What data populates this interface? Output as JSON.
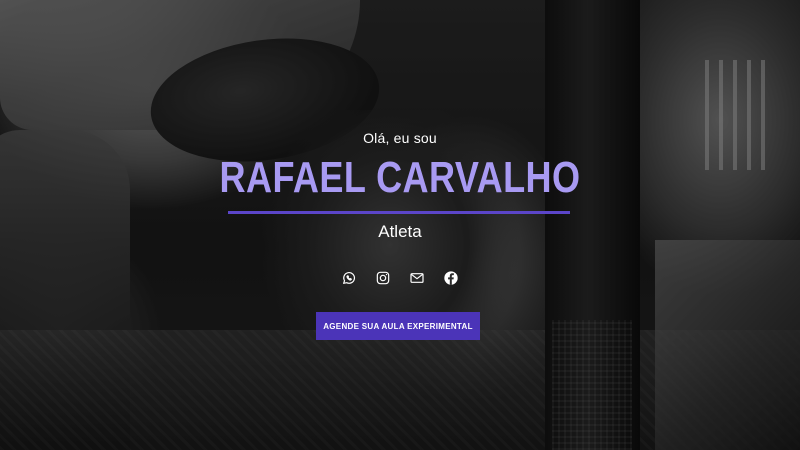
{
  "hero": {
    "greeting": "Olá, eu sou",
    "name": "RAFAEL CARVALHO",
    "role": "Atleta",
    "cta_label": "AGENDE SUA AULA EXPERIMENTAL"
  },
  "social": [
    {
      "icon": "whatsapp-icon"
    },
    {
      "icon": "instagram-icon"
    },
    {
      "icon": "email-icon"
    },
    {
      "icon": "facebook-icon"
    }
  ],
  "colors": {
    "name": "#a89af2",
    "accent": "#5b45c9",
    "button": "#4b34b8"
  }
}
